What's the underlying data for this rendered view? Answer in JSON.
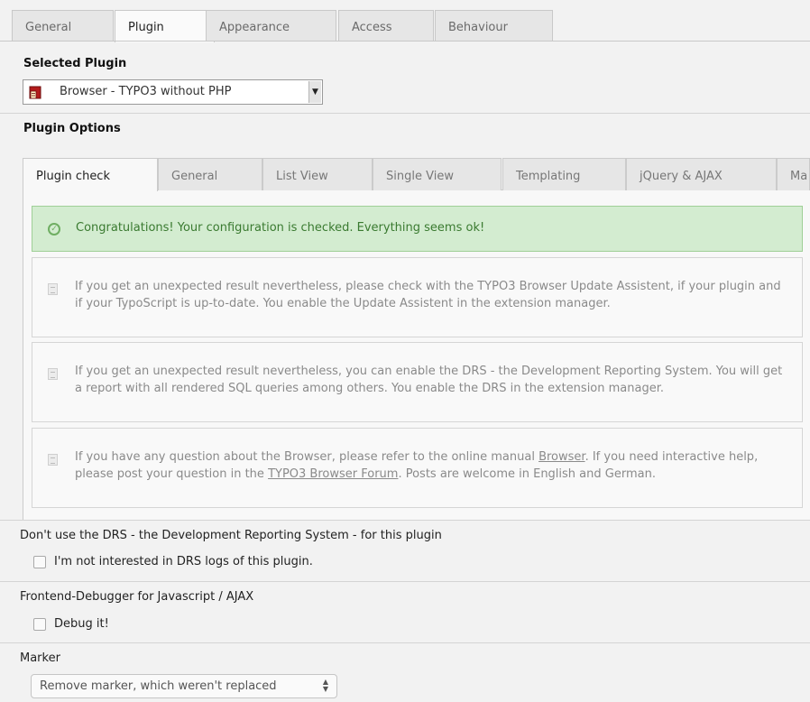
{
  "top_tabs": [
    "General",
    "Plugin",
    "Appearance",
    "Access",
    "Behaviour"
  ],
  "top_tab_active": "Plugin",
  "selected_plugin": {
    "label": "Selected Plugin",
    "value": "Browser - TYPO3 without PHP",
    "icon": "plugin-brick-icon"
  },
  "plugin_options": {
    "label": "Plugin Options",
    "tabs": [
      "Plugin check",
      "General",
      "List View",
      "Single View",
      "Templating",
      "jQuery & AJAX",
      "Ma"
    ],
    "active_tab": "Plugin check"
  },
  "messages": {
    "ok": "Congratulations! Your configuration is checked. Everything seems ok!",
    "info1": "If you get an unexpected result nevertheless, please check with the TYPO3 Browser Update Assistent, if your plugin and if your TypoScript is up-to-date. You enable the Update Assistent in the extension manager.",
    "info2": "If you get an unexpected result nevertheless, you can enable the DRS - the Development Reporting System. You will get a report with all rendered SQL queries among others. You enable the DRS in the extension manager.",
    "info3_a": "If you have any question about the Browser, please refer to the online manual ",
    "info3_link1": "Browser",
    "info3_b": ". If you need interactive help, please post your question in the ",
    "info3_link2": "TYPO3 Browser Forum",
    "info3_c": ". Posts are welcome in English and German."
  },
  "drs": {
    "label": "Don't use the DRS - the Development Reporting System - for this plugin",
    "checkbox_label": "I'm not interested in DRS logs of this plugin.",
    "checked": false
  },
  "debugger": {
    "label": "Frontend-Debugger for Javascript / AJAX",
    "checkbox_label": "Debug it!",
    "checked": false
  },
  "marker": {
    "label": "Marker",
    "value": "Remove marker, which weren't replaced"
  },
  "colors": {
    "success_bg": "#d3ecd0",
    "success_text": "#3a7a30",
    "panel_bg": "#f2f2f2"
  }
}
